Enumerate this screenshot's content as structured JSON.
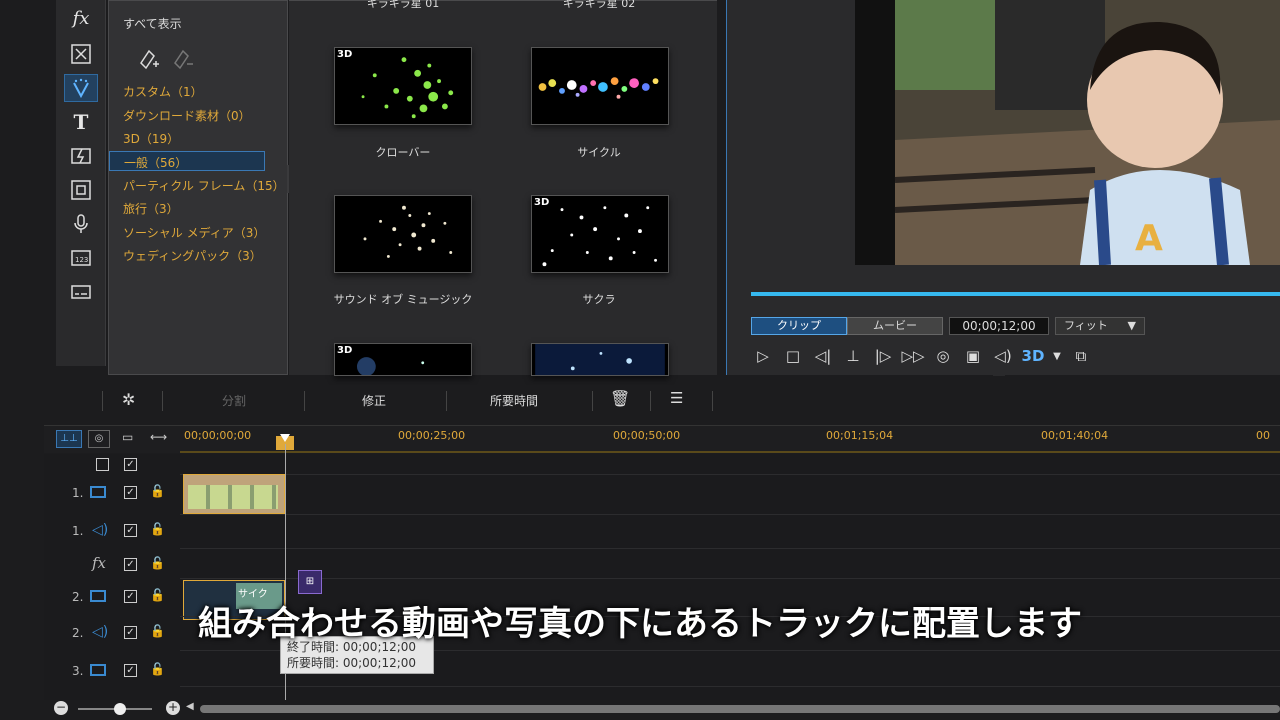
{
  "rail": {
    "icons": [
      "fx-icon",
      "particle-room-icon",
      "effect-spray-icon",
      "title-icon",
      "transition-icon",
      "pip-icon",
      "audio-mic-icon",
      "chapter-icon",
      "subtitle-icon"
    ]
  },
  "categories": {
    "show_all": "すべて表示",
    "items": [
      {
        "label": "カスタム（1）"
      },
      {
        "label": "ダウンロード素材（0）"
      },
      {
        "label": "3D（19）"
      },
      {
        "label": "一般（56）",
        "selected": true
      },
      {
        "label": "パーティクル フレーム（15）"
      },
      {
        "label": "旅行（3）"
      },
      {
        "label": "ソーシャル メディア（3）"
      },
      {
        "label": "ウェディングパック（3）"
      }
    ]
  },
  "templates": {
    "top_cut": [
      "キラキラ星 01",
      "キラキラ星 02"
    ],
    "items": [
      {
        "label": "クローバー",
        "badge": "3D",
        "palette": "#8be84a"
      },
      {
        "label": "サイクル",
        "badge": "",
        "palette": "#f0c040"
      },
      {
        "label": "サウンド オブ ミュージック",
        "badge": "",
        "palette": "#ffffff"
      },
      {
        "label": "サクラ",
        "badge": "3D",
        "palette": "#ffffff"
      },
      {
        "label": "",
        "badge": "3D",
        "palette": "#7fb2ff"
      },
      {
        "label": "",
        "badge": "",
        "palette": "#a6d8ff"
      }
    ]
  },
  "preview": {
    "mode_clip": "クリップ",
    "mode_movie": "ムービー",
    "timecode": "00;00;12;00",
    "fit": "フィット",
    "progress": 1.0
  },
  "toolbar": {
    "split": "分割",
    "fix": "修正",
    "duration": "所要時間"
  },
  "ruler": {
    "ticks": [
      "00;00;00;00",
      "00;00;25;00",
      "00;00;50;00",
      "00;01;15;04",
      "00;01;40;04",
      "00"
    ]
  },
  "tracks": [
    {
      "num": "",
      "type": "video-master"
    },
    {
      "num": "1.",
      "type": "video"
    },
    {
      "num": "1.",
      "type": "audio"
    },
    {
      "num": "fx",
      "type": "fx"
    },
    {
      "num": "2.",
      "type": "video"
    },
    {
      "num": "2.",
      "type": "audio"
    },
    {
      "num": "3.",
      "type": "video"
    }
  ],
  "clip_label": "サイク",
  "tooltip": {
    "end": "終了時間: 00;00;12;00",
    "duration": "所要時間: 00;00;12;00"
  },
  "subtitle": "組み合わせる動画や写真の下にあるトラックに配置します"
}
